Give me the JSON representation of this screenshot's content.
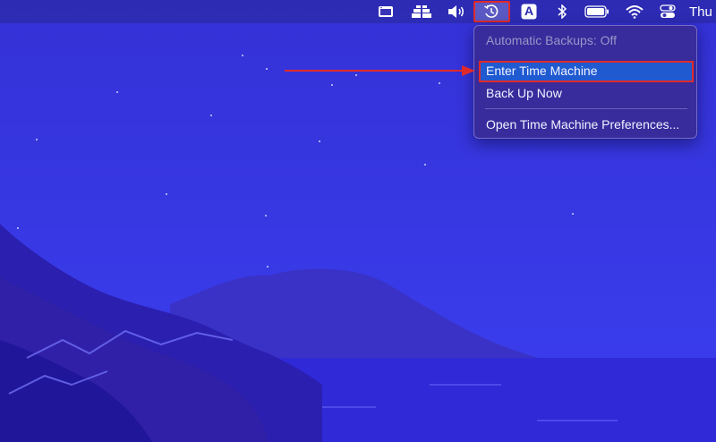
{
  "menubar": {
    "icons": [
      {
        "name": "window-icon"
      },
      {
        "name": "sidebar-app-icon"
      },
      {
        "name": "volume-icon"
      },
      {
        "name": "time-machine-icon"
      },
      {
        "name": "input-source-icon",
        "glyph": "A"
      },
      {
        "name": "bluetooth-icon"
      },
      {
        "name": "battery-icon"
      },
      {
        "name": "wifi-icon"
      },
      {
        "name": "control-center-icon"
      }
    ],
    "clock": "Thu"
  },
  "time_machine_menu": {
    "status": "Automatic Backups: Off",
    "items": {
      "enter": "Enter Time Machine",
      "backup": "Back Up Now",
      "preferences": "Open Time Machine Preferences..."
    }
  },
  "colors": {
    "highlight_border": "#e02a2a",
    "selection": "#1f5ad1",
    "annotation_arrow": "#e02a2a"
  }
}
